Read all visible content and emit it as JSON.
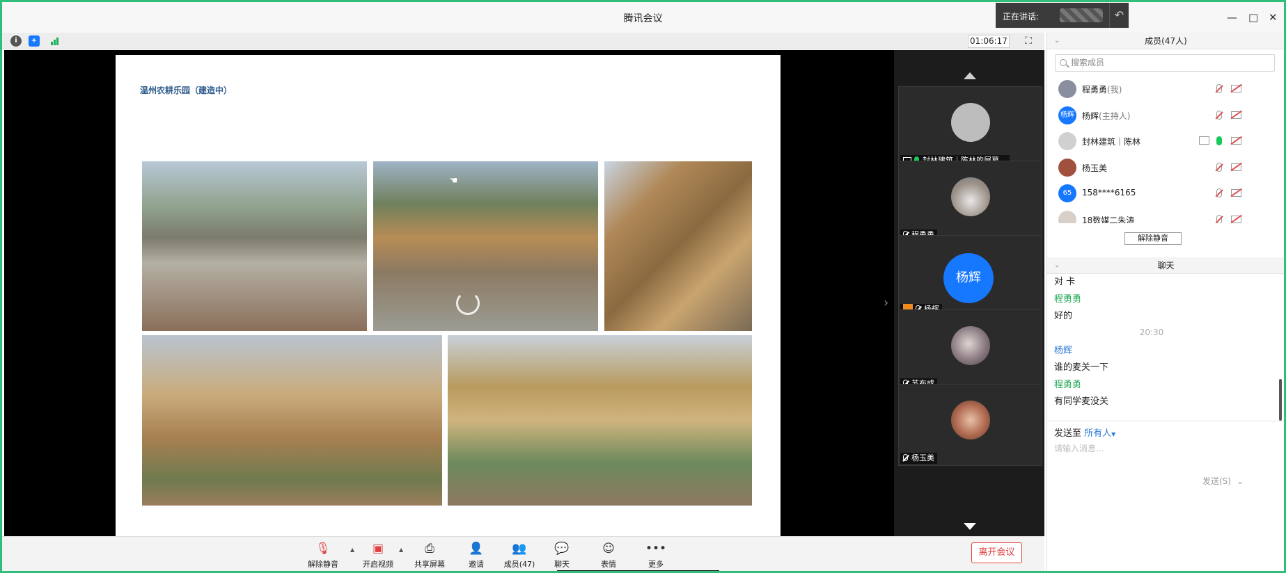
{
  "window": {
    "title": "腾讯会议",
    "controls": [
      "—",
      "□",
      "✕"
    ]
  },
  "speaking": {
    "label": "正在讲话:"
  },
  "meeting": {
    "timer": "01:06:17"
  },
  "slide": {
    "title": "温州农耕乐园（建造中）"
  },
  "video_tiles": [
    {
      "name": "封林建筑｜陈林的屏幕...",
      "mic": "on",
      "sharing": true,
      "host": false,
      "avatar_text": ""
    },
    {
      "name": "程勇勇",
      "mic": "muted",
      "sharing": false,
      "host": false,
      "avatar_text": ""
    },
    {
      "name": "杨辉",
      "mic": "muted",
      "sharing": false,
      "host": true,
      "avatar_text": "杨辉"
    },
    {
      "name": "苏布成",
      "mic": "muted",
      "sharing": false,
      "host": false,
      "avatar_text": ""
    },
    {
      "name": "杨玉美",
      "mic": "muted",
      "sharing": false,
      "host": false,
      "avatar_text": ""
    }
  ],
  "bottom_bar": {
    "unmute": "解除静音",
    "video": "开启视频",
    "share": "共享屏幕",
    "invite": "邀请",
    "members": "成员(47)",
    "chat": "聊天",
    "reaction": "表情",
    "more": "更多",
    "leave": "离开会议"
  },
  "members_panel": {
    "title": "成员(47人)",
    "search_placeholder": "搜索成员",
    "unmute_all": "解除静音",
    "list": [
      {
        "name": "程勇勇",
        "role": "(我)",
        "avatar_text": "",
        "avatar_color": "#8a8fa0",
        "mic": "muted",
        "share": false
      },
      {
        "name": "杨辉",
        "role": "(主持人)",
        "avatar_text": "杨辉",
        "avatar_color": "#1677ff",
        "mic": "muted",
        "share": false
      },
      {
        "name": "封林建筑｜陈林",
        "role": "",
        "avatar_text": "",
        "avatar_color": "#d0d0d0",
        "mic": "on",
        "share": true
      },
      {
        "name": "杨玉美",
        "role": "",
        "avatar_text": "",
        "avatar_color": "#a0503c",
        "mic": "muted",
        "share": false
      },
      {
        "name": "158****6165",
        "role": "",
        "avatar_text": "65",
        "avatar_color": "#1677ff",
        "mic": "muted",
        "share": false
      },
      {
        "name": "18数媒二朱涛",
        "role": "",
        "avatar_text": "",
        "avatar_color": "#d8d0c8",
        "mic": "muted",
        "share": false
      }
    ]
  },
  "chat_panel": {
    "title": "聊天",
    "messages": [
      {
        "sender": "",
        "text": "对 卡"
      },
      {
        "sender": "程勇勇",
        "text": "好的"
      },
      {
        "time": "20:30"
      },
      {
        "sender": "杨辉",
        "text": "谁的麦关一下"
      },
      {
        "sender": "程勇勇",
        "text": "有同学麦没关"
      }
    ],
    "send_to_label": "发送至",
    "send_to_target": "所有人",
    "input_placeholder": "请输入消息...",
    "send_button": "发送(S)"
  },
  "colors": {
    "accent": "#1677ff",
    "frame": "#2fbf7a",
    "leave": "#e04040",
    "chat_green": "#1da750"
  }
}
